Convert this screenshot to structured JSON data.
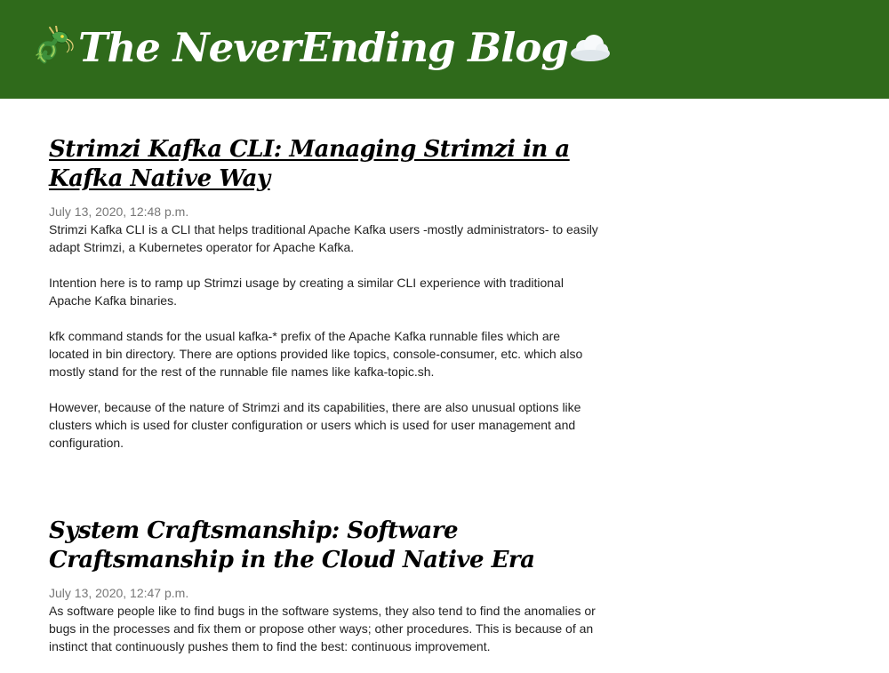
{
  "header": {
    "title": "The NeverEnding Blog",
    "bg_color": "#2f6a1b",
    "left_icon": "dragon-icon",
    "right_icon": "cloud-icon"
  },
  "posts": [
    {
      "title": "Strimzi Kafka CLI: Managing Strimzi in a Kafka Native Way",
      "date": "July 13, 2020, 12:48 p.m.",
      "paragraphs": [
        "Strimzi Kafka CLI is a CLI that helps traditional Apache Kafka users -mostly administrators- to easily adapt Strimzi, a Kubernetes operator for Apache Kafka.",
        "Intention here is to ramp up Strimzi usage by creating a similar CLI experience with traditional Apache Kafka binaries.",
        "kfk command stands for the usual kafka-* prefix of the Apache Kafka runnable files which are located in bin directory. There are options provided like topics, console-consumer, etc. which also mostly stand for the rest of the runnable file names like kafka-topic.sh.",
        "However, because of the nature of Strimzi and its capabilities, there are also unusual options like clusters which is used for cluster configuration or users which is used for user management and configuration."
      ]
    },
    {
      "title": "System Craftsmanship: Software Craftsmanship in the Cloud Native Era",
      "date": "July 13, 2020, 12:47 p.m.",
      "paragraphs": [
        "As software people like to find bugs in the software systems, they also tend to find the anomalies or bugs in the processes and fix them or propose other ways; other procedures. This is because of an instinct that continuously pushes them to find the best: continuous improvement."
      ]
    }
  ]
}
